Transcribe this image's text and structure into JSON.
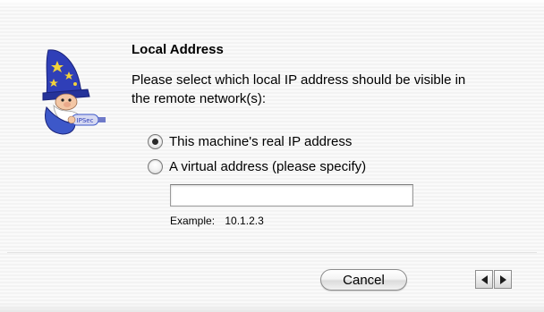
{
  "dialog": {
    "title": "Local Address",
    "prompt": "Please select which local IP address should be visible in the remote network(s):",
    "options": [
      {
        "label": "This machine's real IP address",
        "selected": true
      },
      {
        "label": "A virtual address (please specify)",
        "selected": false
      }
    ],
    "virtual_address_value": "",
    "example_label": "Example:",
    "example_value": "10.1.2.3",
    "logo_text": "IPSec",
    "icon": "wizard-icon"
  },
  "buttons": {
    "cancel": "Cancel",
    "back_icon": "triangle-left-icon",
    "forward_icon": "triangle-right-icon"
  },
  "colors": {
    "wizard_hat": "#2f3fb8",
    "wizard_star": "#f2d23b",
    "wizard_robe": "#3d58c9"
  }
}
